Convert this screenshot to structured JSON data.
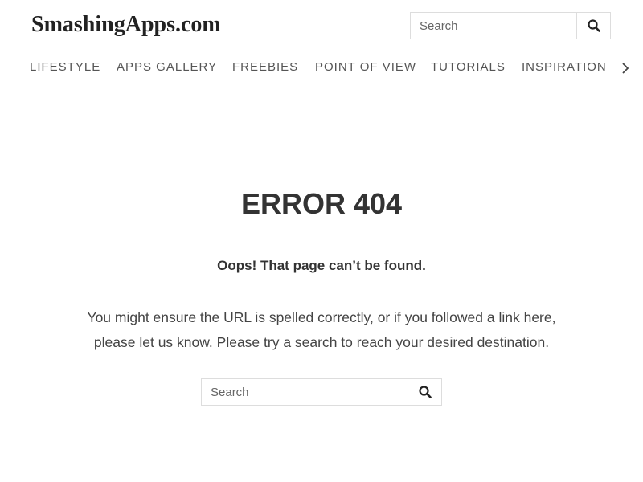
{
  "header": {
    "logo": "SmashingApps.com",
    "search": {
      "placeholder": "Search"
    }
  },
  "nav": {
    "items": [
      "Lifestyle",
      "Apps Gallery",
      "Freebies",
      "Point of View",
      "Tutorials",
      "Inspiration"
    ],
    "more_icon": "chevron-right-icon"
  },
  "main": {
    "title": "ERROR 404",
    "subtitle": "Oops! That page can’t be found.",
    "description_line1": "You might ensure the URL is spelled correctly, or if you followed a link here,",
    "description_line2": "please let us know. Please try a search to reach your desired destination.",
    "search": {
      "placeholder": "Search"
    }
  },
  "icons": {
    "search": "search-icon"
  }
}
